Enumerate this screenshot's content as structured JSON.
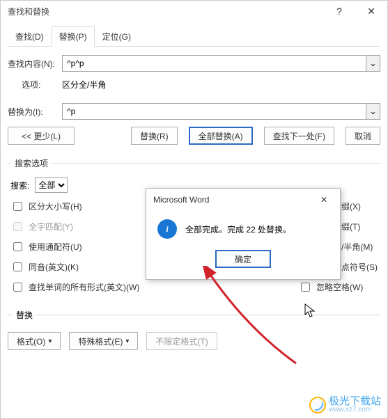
{
  "window": {
    "title": "查找和替换",
    "help": "?",
    "close": "✕"
  },
  "tabs": {
    "find": "查找(D)",
    "replace": "替换(P)",
    "goto": "定位(G)"
  },
  "find_label": "查找内容(N):",
  "find_value": "^p^p",
  "options_label": "选项:",
  "options_value": "区分全/半角",
  "replace_label": "替换为(I):",
  "replace_value": "^p",
  "buttons": {
    "less": "<< 更少(L)",
    "replace_one": "替换(R)",
    "replace_all": "全部替换(A)",
    "find_next": "查找下一处(F)",
    "cancel": "取消"
  },
  "search_options": {
    "legend": "搜索选项",
    "search_label": "搜索:",
    "search_value": "全部",
    "left": [
      {
        "key": "match_case",
        "label": "区分大小写(H)",
        "checked": false,
        "disabled": false
      },
      {
        "key": "whole_word",
        "label": "全字匹配(Y)",
        "checked": false,
        "disabled": true
      },
      {
        "key": "wildcards",
        "label": "使用通配符(U)",
        "checked": false,
        "disabled": false
      },
      {
        "key": "sounds_like",
        "label": "同音(英文)(K)",
        "checked": false,
        "disabled": false
      },
      {
        "key": "word_forms",
        "label": "查找单词的所有形式(英文)(W)",
        "checked": false,
        "disabled": false
      }
    ],
    "right": [
      {
        "key": "prefix",
        "label": "区分前缀(X)",
        "checked": false
      },
      {
        "key": "suffix",
        "label": "区分后缀(T)",
        "checked": false
      },
      {
        "key": "fullhalf",
        "label": "区分全/半角(M)",
        "checked": true
      },
      {
        "key": "ignore_punct",
        "label": "忽略标点符号(S)",
        "checked": false
      },
      {
        "key": "ignore_space",
        "label": "忽略空格(W)",
        "checked": false
      }
    ]
  },
  "replace_section": {
    "label": "替换",
    "format": "格式(O)",
    "special": "特殊格式(E)",
    "no_format": "不限定格式(T)"
  },
  "modal": {
    "title": "Microsoft Word",
    "close": "✕",
    "info_icon": "i",
    "message": "全部完成。完成 22 处替换。",
    "ok": "确定"
  },
  "watermark": {
    "line1": "极光下载站",
    "line2": "www.xz7.com"
  },
  "cursor_arrow_color": "#d2232a"
}
